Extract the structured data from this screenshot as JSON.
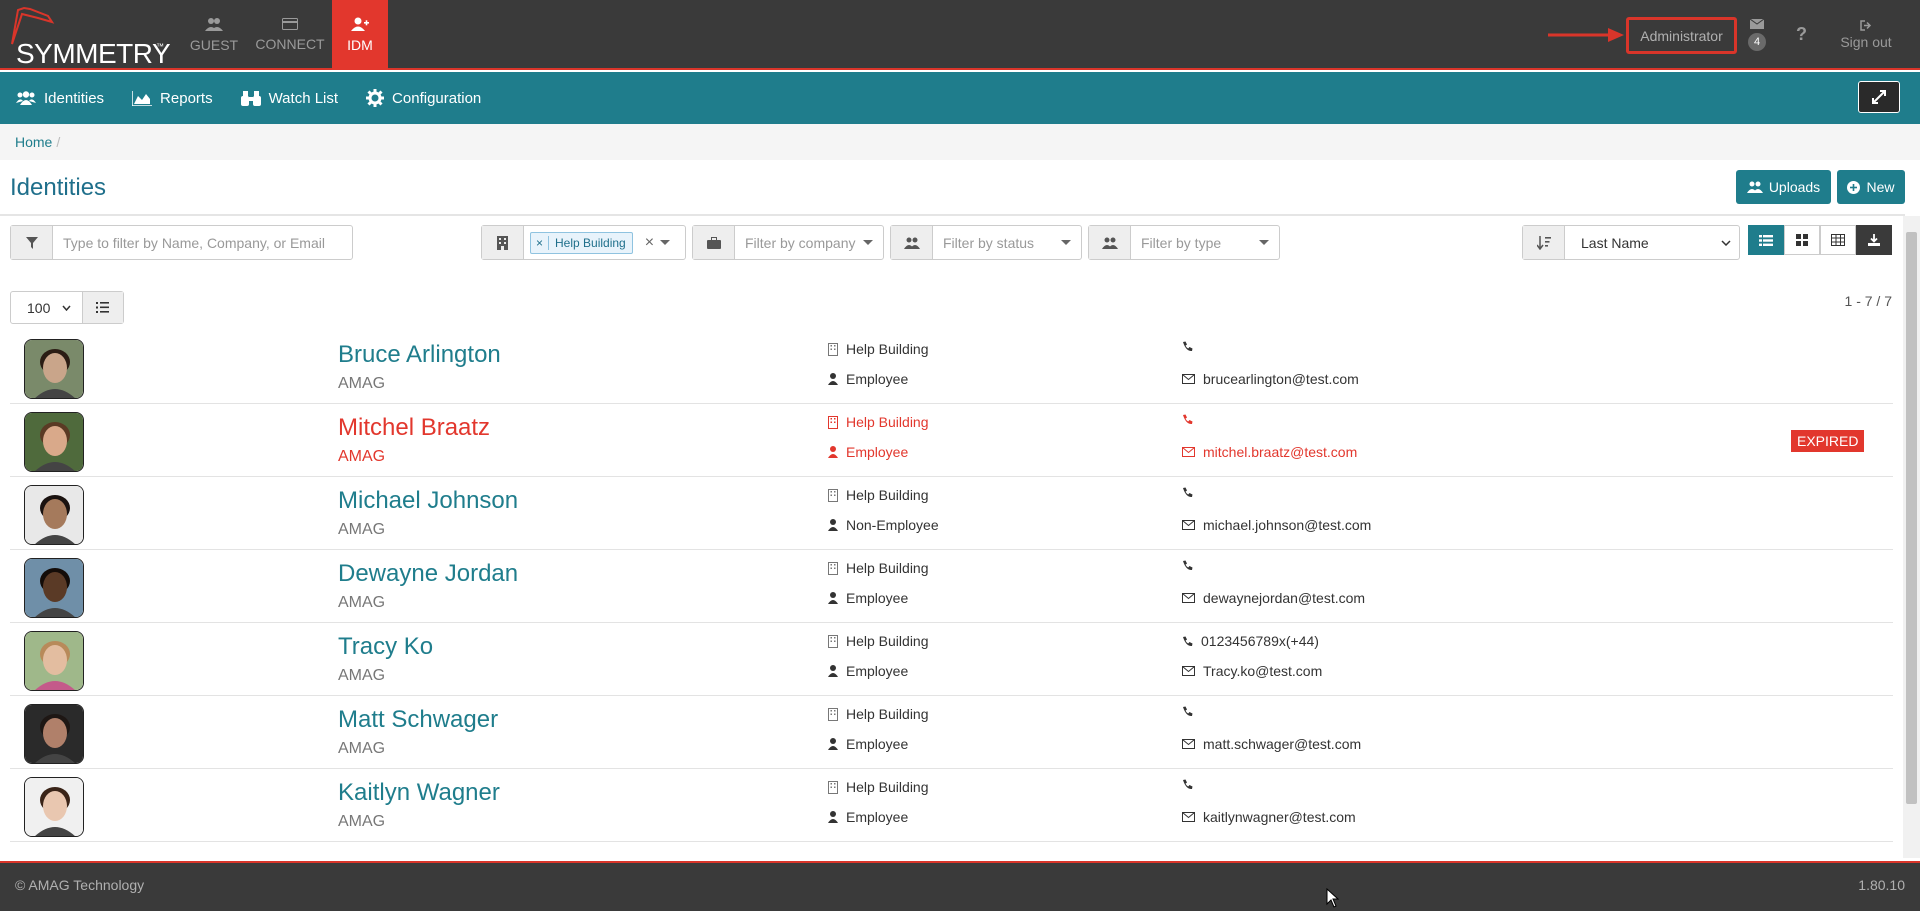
{
  "brand": {
    "name": "SYMMETRY",
    "tm": "™"
  },
  "apps": [
    {
      "label": "GUEST",
      "icon": "users-icon"
    },
    {
      "label": "CONNECT",
      "icon": "card-icon"
    },
    {
      "label": "IDM",
      "icon": "user-plus-icon",
      "active": true
    }
  ],
  "topbar": {
    "user": "Administrator",
    "messages_count": "4",
    "help": "?",
    "signout": "Sign out"
  },
  "subnav": [
    {
      "label": "Identities",
      "icon": "users-icon"
    },
    {
      "label": "Reports",
      "icon": "area-chart-icon"
    },
    {
      "label": "Watch List",
      "icon": "binoculars-icon"
    },
    {
      "label": "Configuration",
      "icon": "gear-icon"
    }
  ],
  "breadcrumb": {
    "home": "Home",
    "sep": "/"
  },
  "page": {
    "title": "Identities",
    "uploads": "Uploads",
    "new": "New"
  },
  "filters": {
    "search_placeholder": "Type to filter by Name, Company, or Email",
    "building_tag": "Help Building",
    "company_placeholder": "Filter by company",
    "status_placeholder": "Filter by status",
    "type_placeholder": "Filter by type",
    "sort_value": "Last Name",
    "page_size": "100",
    "count": "1 - 7 / 7"
  },
  "identities": [
    {
      "name": "Bruce Arlington",
      "company": "AMAG",
      "building": "Help Building",
      "type": "Employee",
      "phone": "",
      "email": "brucearlington@test.com",
      "expired": false,
      "skin": "#c9a58a",
      "hair": "#2b1d14",
      "bg": "#7a8a6a"
    },
    {
      "name": "Mitchel Braatz",
      "company": "AMAG",
      "building": "Help Building",
      "type": "Employee",
      "phone": "",
      "email": "mitchel.braatz@test.com",
      "expired": true,
      "skin": "#d9a98a",
      "hair": "#5a3a24",
      "bg": "#4f6a3c"
    },
    {
      "name": "Michael Johnson",
      "company": "AMAG",
      "building": "Help Building",
      "type": "Non-Employee",
      "phone": "",
      "email": "michael.johnson@test.com",
      "expired": false,
      "skin": "#a57a5c",
      "hair": "#1a1210",
      "bg": "#e8e8e8"
    },
    {
      "name": "Dewayne Jordan",
      "company": "AMAG",
      "building": "Help Building",
      "type": "Employee",
      "phone": "",
      "email": "dewaynejordan@test.com",
      "expired": false,
      "skin": "#5a3a26",
      "hair": "#140c08",
      "bg": "#6f8fa8"
    },
    {
      "name": "Tracy Ko",
      "company": "AMAG",
      "building": "Help Building",
      "type": "Employee",
      "phone": "0123456789x(+44)",
      "email": "Tracy.ko@test.com",
      "expired": false,
      "skin": "#e3bda0",
      "hair": "#b88a5a",
      "bg": "#9fb88a"
    },
    {
      "name": "Matt Schwager",
      "company": "AMAG",
      "building": "Help Building",
      "type": "Employee",
      "phone": "",
      "email": "matt.schwager@test.com",
      "expired": false,
      "skin": "#b0806a",
      "hair": "#1e1714",
      "bg": "#2a2a2a"
    },
    {
      "name": "Kaitlyn Wagner",
      "company": "AMAG",
      "building": "Help Building",
      "type": "Employee",
      "phone": "",
      "email": "kaitlynwagner@test.com",
      "expired": false,
      "skin": "#e9c7b0",
      "hair": "#3a2418",
      "bg": "#f0f0f0"
    }
  ],
  "expired_label": "EXPIRED",
  "footer": {
    "copyright": "© AMAG Technology",
    "version": "1.80.10"
  },
  "colors": {
    "teal": "#1f7d8c",
    "red": "#e2372d",
    "dark": "#3a3a3a"
  }
}
